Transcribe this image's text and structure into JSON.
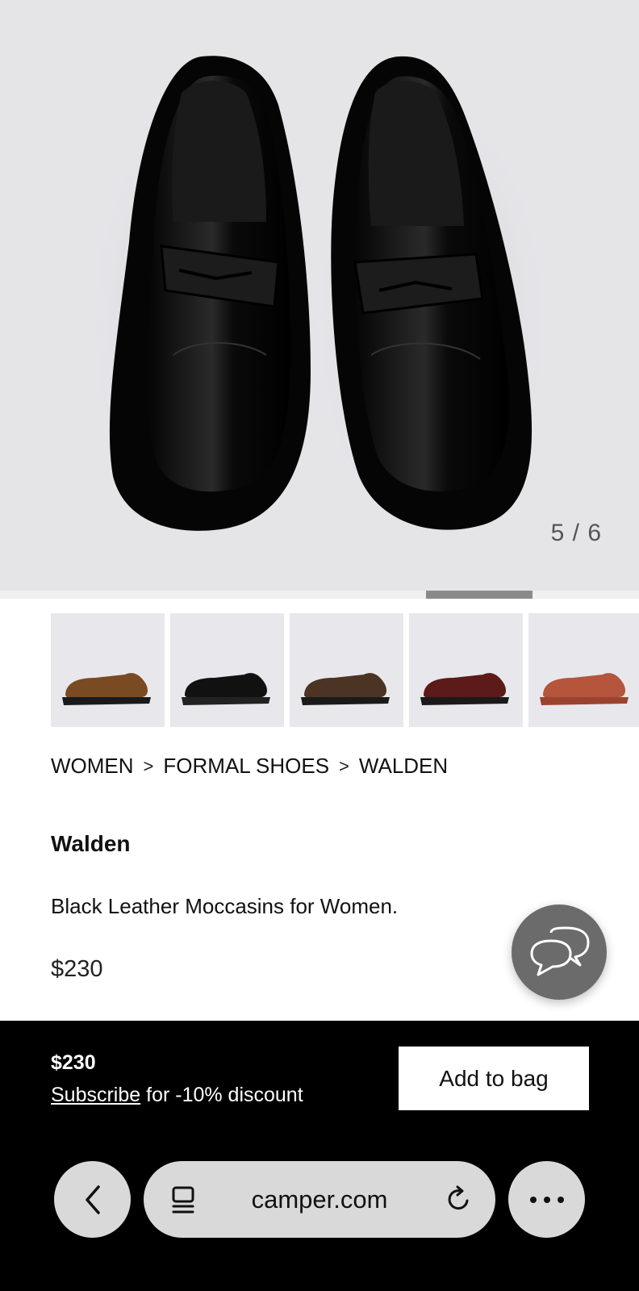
{
  "gallery": {
    "counter": "5 / 6",
    "current_index": 5,
    "total": 6,
    "progress_fraction": 0.17
  },
  "thumbnails": [
    {
      "name": "thumb-brown",
      "color": "#7a4a22"
    },
    {
      "name": "thumb-black",
      "color": "#111111"
    },
    {
      "name": "thumb-dark-brown",
      "color": "#4b3424"
    },
    {
      "name": "thumb-burgundy",
      "color": "#5c1a18"
    },
    {
      "name": "thumb-terracotta",
      "color": "#b5553b"
    }
  ],
  "breadcrumb": {
    "items": [
      "WOMEN",
      "FORMAL SHOES",
      "WALDEN"
    ],
    "separator": ">"
  },
  "product": {
    "title": "Walden",
    "description": "Black Leather Moccasins for Women.",
    "price": "$230"
  },
  "bottom_bar": {
    "price": "$230",
    "subscribe_link": "Subscribe",
    "subscribe_rest": " for -10% discount",
    "add_to_bag": "Add to bag"
  },
  "browser": {
    "url": "camper.com",
    "back_icon": "chevron-left-icon",
    "tabs_icon": "tabs-icon",
    "reload_icon": "reload-icon",
    "more_icon": "more-icon"
  },
  "colors": {
    "hero_bg": "#e5e5e8",
    "bottom_bg": "#000000",
    "browser_controls": "#d9d9d9"
  }
}
